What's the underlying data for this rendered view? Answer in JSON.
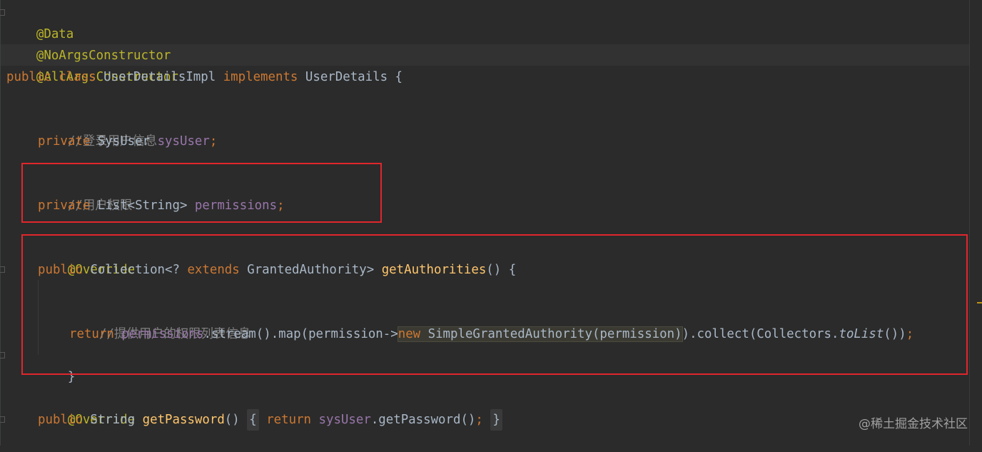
{
  "editor": {
    "lines": {
      "l1": {
        "ann": "@Data"
      },
      "l2": {
        "ann": "@NoArgsConstructor"
      },
      "l3": {
        "ann": "@AllArgsConstructor"
      },
      "l4": {
        "kw1": "public",
        "kw2": "class",
        "name": "UserDetailsImpl",
        "kw3": "implements",
        "iface": "UserDetails",
        "brace": "{"
      },
      "l6": {
        "comment": "//登录用户信息"
      },
      "l7": {
        "kw": "private",
        "type": "SysUser",
        "field": "sysUser",
        "semi": ";"
      },
      "l9": {
        "comment": "//用户权限"
      },
      "l10": {
        "kw": "private",
        "type": "List<String>",
        "field": "permissions",
        "semi": ";"
      },
      "l12": {
        "ann": "@Override"
      },
      "l13": {
        "kw": "public",
        "type": "Collection<?",
        "kw2": "extends",
        "type2": "GrantedAuthority>",
        "method": "getAuthorities",
        "rest": "() {"
      },
      "l15": {
        "comment": "//提供用户的权限列表信息"
      },
      "l16": {
        "kw": "return",
        "field": "permissions",
        "p1": ".stream().map(permission->",
        "kw2": "new",
        "p2": " SimpleGrantedAuthority(permission)",
        "p3": ").collect(Collectors.",
        "italic": "toList",
        "p4": "())",
        "semi": ";"
      },
      "l17": {
        "brace": "}"
      },
      "l19": {
        "ann": "@Override"
      },
      "l20": {
        "kw": "public",
        "type": "String",
        "method": "getPassword",
        "parens": "()",
        "open": "{",
        "kw2": "return",
        "field": "sysUser",
        "p1": ".getPassword()",
        "semi": ";",
        "close": "}"
      }
    }
  },
  "watermark": "@稀土掘金技术社区",
  "colors": {
    "background": "#2b2b2b",
    "annotation": "#bbb529",
    "keyword": "#cc7832",
    "field": "#9876aa",
    "comment": "#808080",
    "method": "#ffc66d",
    "text": "#a9b7c6",
    "highlight_box": "#e0262c"
  }
}
